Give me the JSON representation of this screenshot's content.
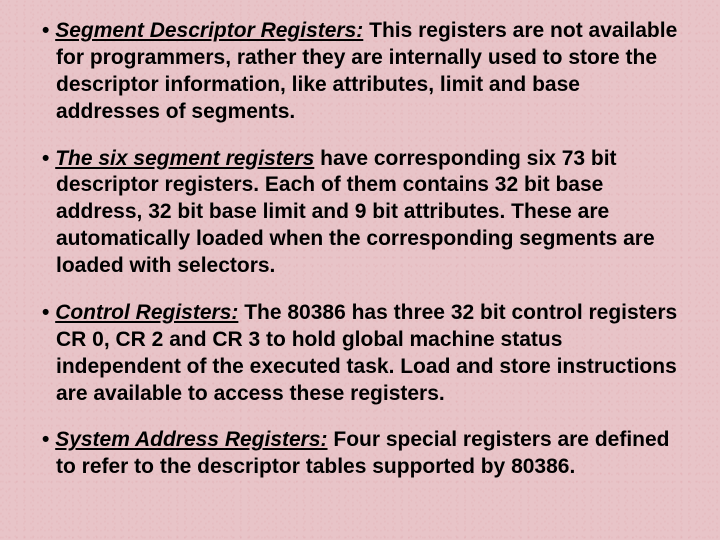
{
  "bullets": [
    {
      "heading": "Segment Descriptor Registers:",
      "body": " This registers are not available for programmers, rather they are internally used to store the descriptor information, like attributes, limit and base addresses of segments."
    },
    {
      "heading": "The six segment registers",
      "body": " have corresponding six 73 bit descriptor registers. Each of them contains 32 bit base address, 32 bit base limit and 9 bit attributes. These are automatically loaded when the corresponding segments are loaded with selectors."
    },
    {
      "heading": "Control Registers:",
      "body": " The 80386 has three 32 bit control registers CR 0, CR 2 and CR 3 to hold global machine status independent of the executed task. Load and store instructions are available to access these registers."
    },
    {
      "heading": "System Address Registers:",
      "body": " Four special registers are defined to refer to the descriptor tables supported by 80386."
    }
  ]
}
